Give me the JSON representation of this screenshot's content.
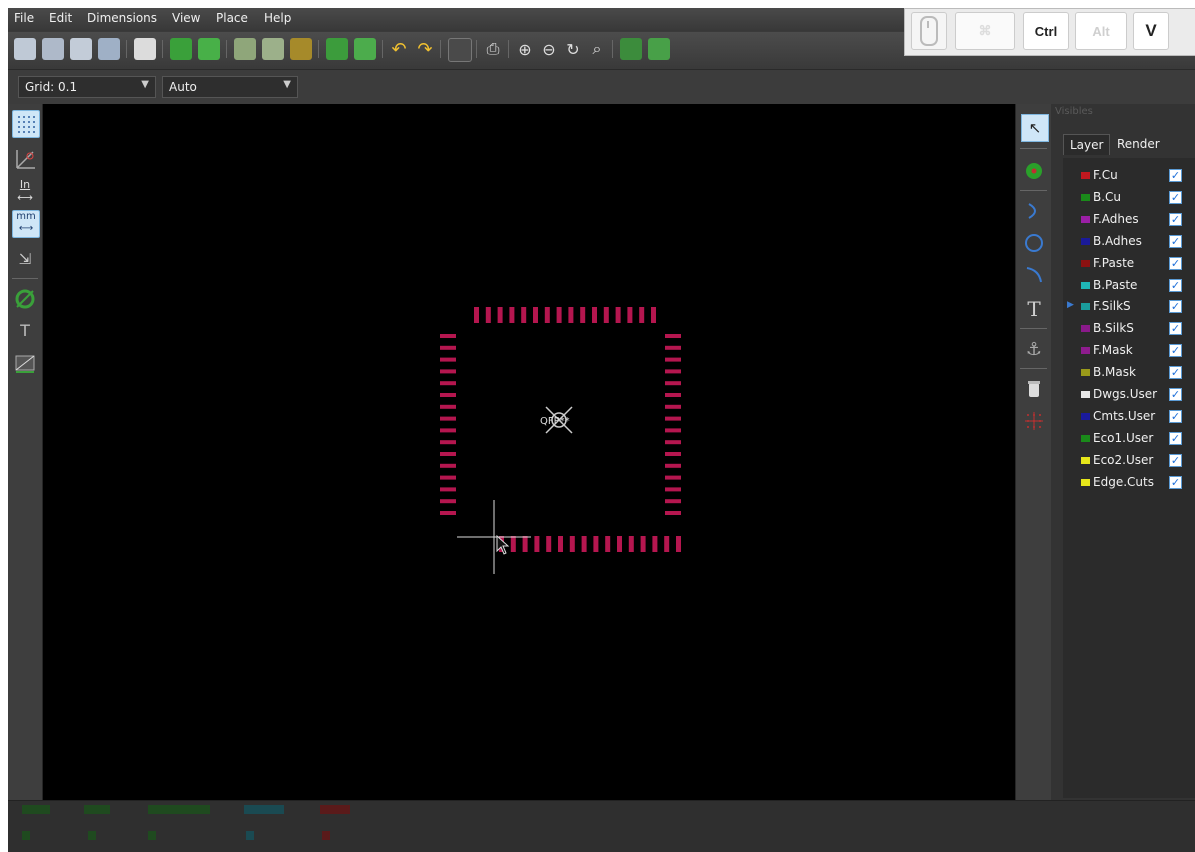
{
  "menubar": {
    "items": [
      "File",
      "Edit",
      "Dimensions",
      "View",
      "Place",
      "Help"
    ]
  },
  "keys": {
    "ctrl": "Ctrl",
    "alt": "Alt",
    "v": "V"
  },
  "options": {
    "grid": "Grid: 0.1",
    "zoom": "Auto"
  },
  "left_toolbar": {
    "inch_label": "In",
    "mm_label": "mm"
  },
  "right_toolbar": {
    "text_tool_glyph": "T"
  },
  "panel": {
    "title": "Visibles",
    "tabs": [
      "Layer",
      "Render"
    ],
    "layers": [
      {
        "name": "F.Cu",
        "color": "#c0181f",
        "checked": true,
        "active": false
      },
      {
        "name": "B.Cu",
        "color": "#1a8a1a",
        "checked": true,
        "active": false
      },
      {
        "name": "F.Adhes",
        "color": "#9b1fa6",
        "checked": true,
        "active": false
      },
      {
        "name": "B.Adhes",
        "color": "#1a1a99",
        "checked": true,
        "active": false
      },
      {
        "name": "F.Paste",
        "color": "#8b1111",
        "checked": true,
        "active": false
      },
      {
        "name": "B.Paste",
        "color": "#1fb5b5",
        "checked": true,
        "active": false
      },
      {
        "name": "F.SilkS",
        "color": "#1a9c9c",
        "checked": true,
        "active": true
      },
      {
        "name": "B.SilkS",
        "color": "#8a1a8a",
        "checked": true,
        "active": false
      },
      {
        "name": "F.Mask",
        "color": "#8e1c8e",
        "checked": true,
        "active": false
      },
      {
        "name": "B.Mask",
        "color": "#9a9a1a",
        "checked": true,
        "active": false
      },
      {
        "name": "Dwgs.User",
        "color": "#e8e8e8",
        "checked": true,
        "active": false
      },
      {
        "name": "Cmts.User",
        "color": "#1a1a9c",
        "checked": true,
        "active": false
      },
      {
        "name": "Eco1.User",
        "color": "#1a8a1a",
        "checked": true,
        "active": false
      },
      {
        "name": "Eco2.User",
        "color": "#e6e61a",
        "checked": true,
        "active": false
      },
      {
        "name": "Edge.Cuts",
        "color": "#e6e61a",
        "checked": true,
        "active": false
      }
    ]
  },
  "canvas": {
    "footprint_ref": "QFP**"
  },
  "colors": {
    "pad": "#b5164f",
    "canvas_bg": "#000000"
  }
}
